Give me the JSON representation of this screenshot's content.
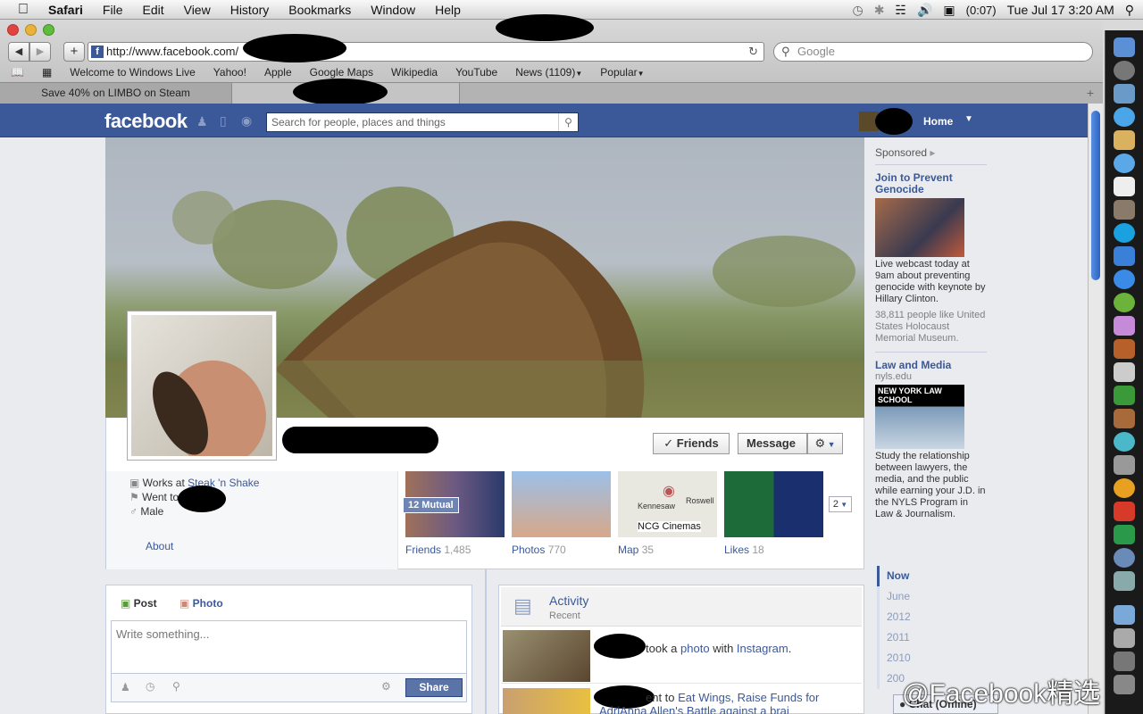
{
  "menubar": {
    "apple": "",
    "app": "Safari",
    "items": [
      "File",
      "Edit",
      "View",
      "History",
      "Bookmarks",
      "Window",
      "Help"
    ],
    "battery": "(0:07)",
    "clock": "Tue Jul 17  3:20 AM"
  },
  "browser": {
    "url": "http://www.facebook.com/",
    "search_placeholder": "Google",
    "bookmarks": [
      "Welcome to Windows Live",
      "Yahoo!",
      "Apple",
      "Google Maps",
      "Wikipedia",
      "YouTube",
      "News (1109)",
      "Popular"
    ],
    "tabs": [
      {
        "title": "Save 40% on LIMBO on Steam"
      },
      {
        "title": ""
      }
    ]
  },
  "facebook": {
    "logo": "facebook",
    "search_placeholder": "Search for people, places and things",
    "home_label": "Home",
    "profile": {
      "work_prefix": "Works at ",
      "work_place": "Steak 'n Shake",
      "school_prefix": "Went to ",
      "gender": "Male",
      "about_link": "About",
      "friends_button": "Friends",
      "message_button": "Message",
      "more_count": "2",
      "mutual_badge": "12 Mutual",
      "map_labels": [
        "Kennesaw",
        "Roswell",
        "NCG Cinemas"
      ]
    },
    "thumbs": [
      {
        "label": "Friends",
        "count": "1,485"
      },
      {
        "label": "Photos",
        "count": "770"
      },
      {
        "label": "Map",
        "count": "35"
      },
      {
        "label": "Likes",
        "count": "18"
      }
    ],
    "composer": {
      "post_tab": "Post",
      "photo_tab": "Photo",
      "placeholder": "Write something...",
      "share_button": "Share"
    },
    "activity": {
      "title": "Activity",
      "subtitle": "Recent",
      "item1_pre": "took a ",
      "item1_link": "photo",
      "item1_mid": " with ",
      "item1_app": "Instagram",
      "item1_end": ".",
      "item2_pre": "ent to ",
      "item2_link": "Eat Wings, Raise Funds for AdriAnna Allen's Battle against a brai"
    },
    "sponsored": {
      "header": "Sponsored",
      "ad1_title": "Join to Prevent Genocide",
      "ad1_text": "Live webcast today at 9am about preventing genocide with keynote by Hillary Clinton.",
      "ad1_likes": "38,811 people like United States Holocaust Memorial Museum.",
      "ad2_title": "Law and Media",
      "ad2_domain": "nyls.edu",
      "ad2_logo": "NEW YORK LAW SCHOOL",
      "ad2_text": "Study the relationship between lawyers, the media, and the public while earning your J.D. in the NYLS Program in Law & Journalism."
    },
    "timeline": [
      "Now",
      "June",
      "2012",
      "2011",
      "2010",
      "200"
    ],
    "chat": "Chat (Offline)"
  },
  "watermark": "@Facebook精选",
  "colors": {
    "fb_blue": "#3b5998",
    "link": "#3b5998"
  }
}
